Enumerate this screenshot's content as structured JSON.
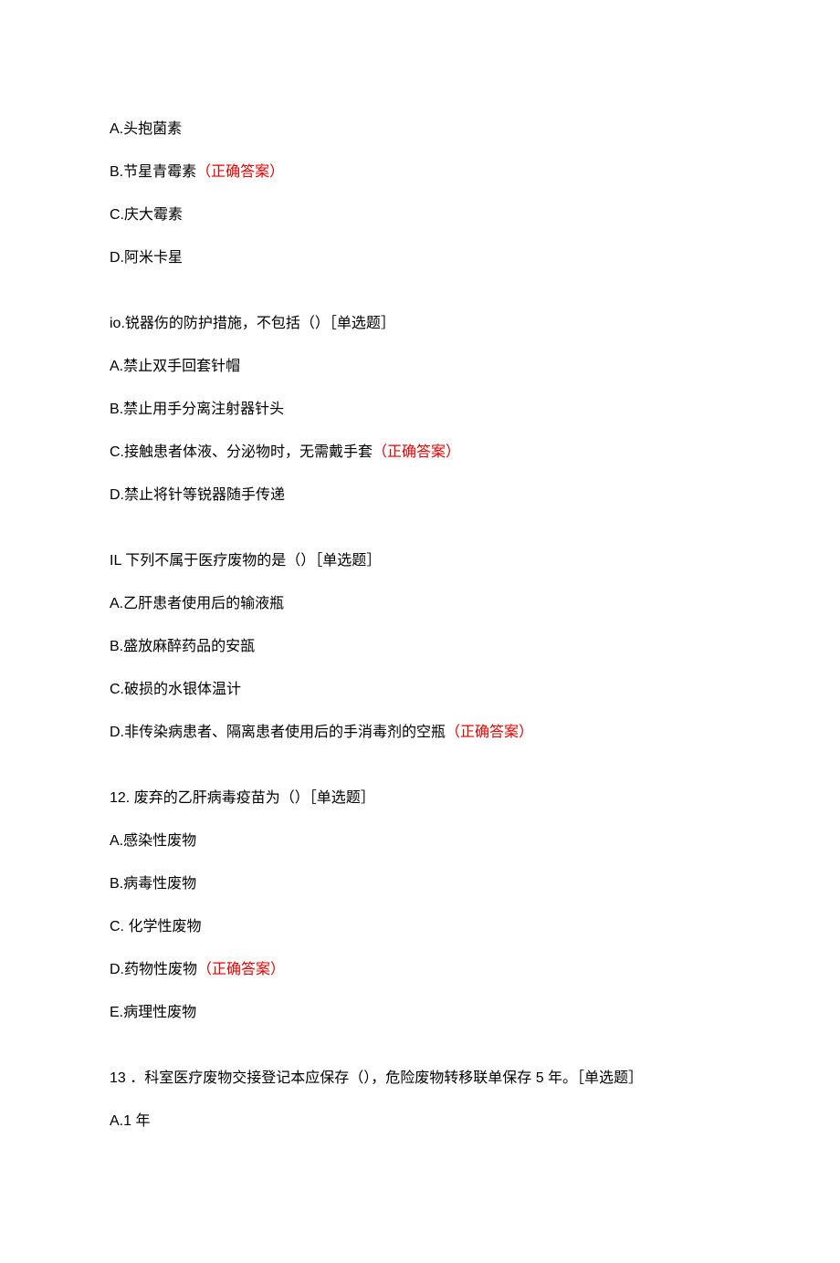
{
  "blocks": [
    {
      "type": "answer",
      "text": "A.头抱菌素",
      "correct": null
    },
    {
      "type": "answer",
      "text": "B.节星青霉素",
      "correct": "（正确答案）"
    },
    {
      "type": "answer",
      "text": "C.庆大霉素",
      "correct": null
    },
    {
      "type": "answer",
      "text": "D.阿米卡星",
      "correct": null
    },
    {
      "type": "question",
      "text": "io.锐器伤的防护措施，不包括（）［单选题］"
    },
    {
      "type": "answer",
      "text": "A.禁止双手回套针帽",
      "correct": null
    },
    {
      "type": "answer",
      "text": "B.禁止用手分离注射器针头",
      "correct": null
    },
    {
      "type": "answer",
      "text": "C.接触患者体液、分泌物时，无需戴手套",
      "correct": "（正确答案）"
    },
    {
      "type": "answer",
      "text": "D.禁止将针等锐器随手传递",
      "correct": null
    },
    {
      "type": "question",
      "text": "IL 下列不属于医疗废物的是（）［单选题］"
    },
    {
      "type": "answer",
      "text": "A.乙肝患者使用后的输液瓶",
      "correct": null
    },
    {
      "type": "answer",
      "text": "B.盛放麻醉药品的安瓿",
      "correct": null
    },
    {
      "type": "answer",
      "text": "C.破损的水银体温计",
      "correct": null
    },
    {
      "type": "answer",
      "text": "D.非传染病患者、隔离患者使用后的手消毒剂的空瓶",
      "correct": "（正确答案）"
    },
    {
      "type": "question",
      "text": "12. 废弃的乙肝病毒疫苗为（）［单选题］"
    },
    {
      "type": "answer",
      "text": "A.感染性废物",
      "correct": null
    },
    {
      "type": "answer",
      "text": "B.病毒性废物",
      "correct": null
    },
    {
      "type": "answer",
      "text": "C. 化学性废物",
      "correct": null
    },
    {
      "type": "answer",
      "text": "D.药物性废物",
      "correct": "（正确答案）"
    },
    {
      "type": "answer",
      "text": "E.病理性废物",
      "correct": null
    },
    {
      "type": "question",
      "text": "13 ．科室医疗废物交接登记本应保存（），危险废物转移联单保存 5 年。［单选题］"
    },
    {
      "type": "answer",
      "text": "A.1 年",
      "correct": null
    }
  ]
}
